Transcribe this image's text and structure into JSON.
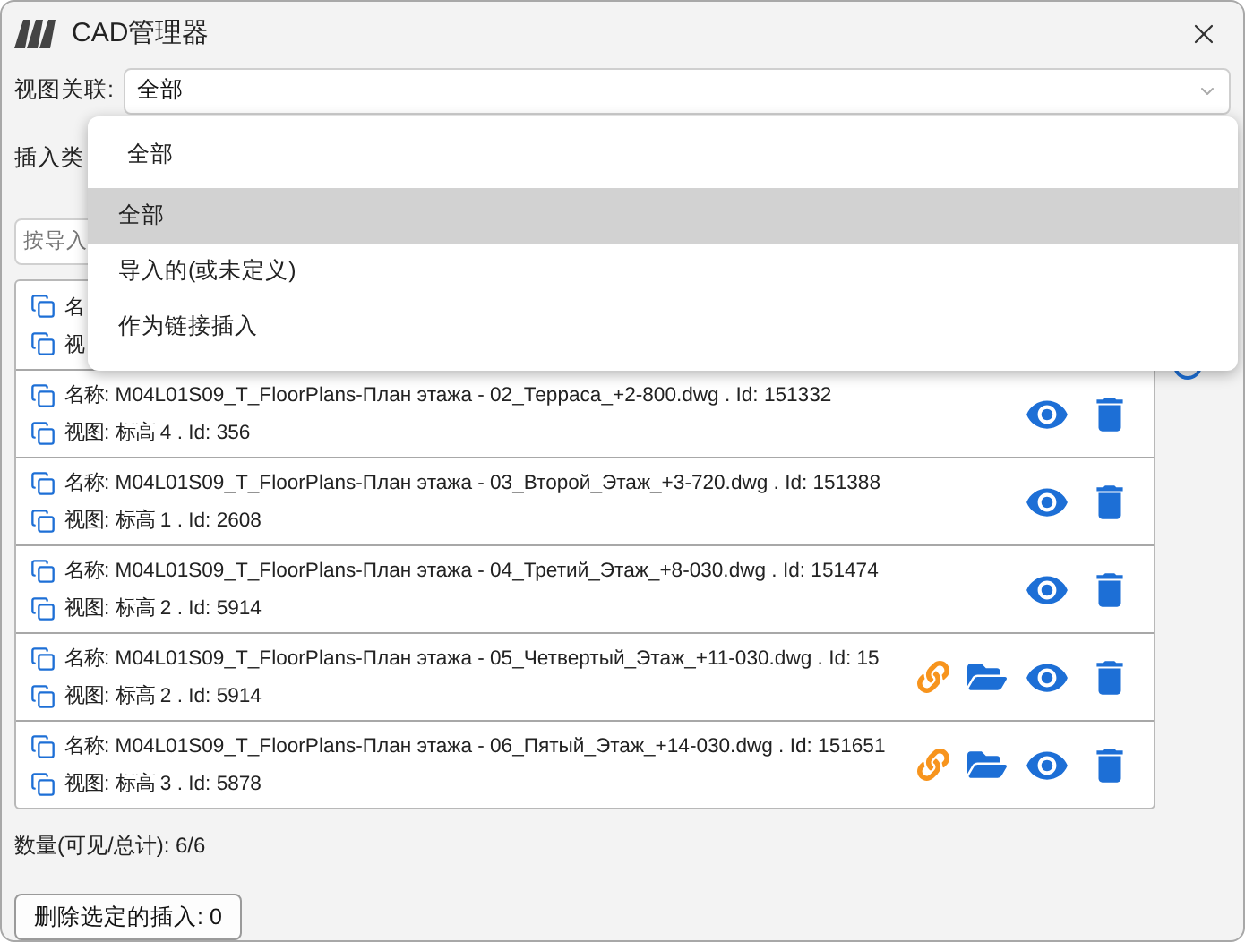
{
  "window": {
    "title": "CAD管理器"
  },
  "view_filter": {
    "label": "视图关联:",
    "value": "全部"
  },
  "insert_type": {
    "label": "插入类"
  },
  "search": {
    "placeholder": "按导入"
  },
  "items": [
    {
      "kind": "covered",
      "name": "名",
      "view": "视"
    },
    {
      "kind": "import",
      "name": "名称: M04L01S09_T_FloorPlans-План этажа - 02_Терраса_+2-800.dwg . Id: 151332",
      "view": "视图: 标高 4 . Id: 356"
    },
    {
      "kind": "import",
      "name": "名称: M04L01S09_T_FloorPlans-План этажа - 03_Второй_Этаж_+3-720.dwg . Id: 151388",
      "view": "视图: 标高 1 . Id: 2608"
    },
    {
      "kind": "import",
      "name": "名称: M04L01S09_T_FloorPlans-План этажа - 04_Третий_Этаж_+8-030.dwg . Id: 151474",
      "view": "视图: 标高 2 . Id: 5914"
    },
    {
      "kind": "link",
      "name": "名称: M04L01S09_T_FloorPlans-План этажа - 05_Четвертый_Этаж_+11-030.dwg . Id: 15",
      "view": "视图: 标高 2 . Id: 5914"
    },
    {
      "kind": "link",
      "name": "名称: M04L01S09_T_FloorPlans-План этажа - 06_Пятый_Этаж_+14-030.dwg . Id: 151651",
      "view": "视图: 标高 3 . Id: 5878"
    }
  ],
  "count": "数量(可见/总计): 6/6",
  "delete_button": "删除选定的插入: 0",
  "dropdown": {
    "value": "全部",
    "options": [
      {
        "label": "全部",
        "selected": true
      },
      {
        "label": "导入的(或未定义)",
        "selected": false
      },
      {
        "label": "作为链接插入",
        "selected": false
      }
    ]
  }
}
